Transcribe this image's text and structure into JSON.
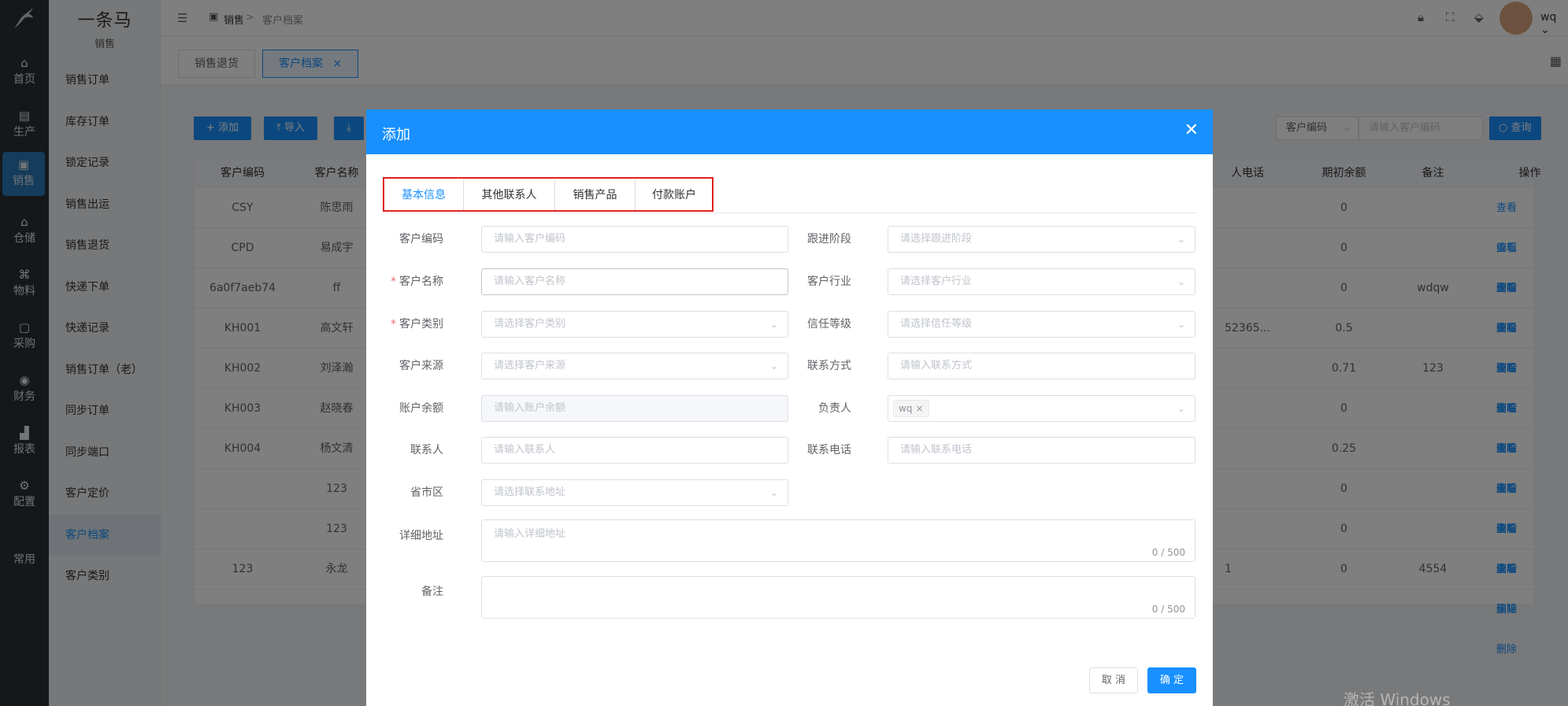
{
  "brand": {
    "name": "一条马",
    "module": "销售"
  },
  "rail": [
    {
      "label": "首页",
      "icon": "home-icon",
      "glyph": "⌂"
    },
    {
      "label": "生产",
      "icon": "factory-icon",
      "glyph": "▤"
    },
    {
      "label": "销售",
      "icon": "sales-icon",
      "glyph": "▣"
    },
    {
      "label": "仓储",
      "icon": "warehouse-icon",
      "glyph": "⌂"
    },
    {
      "label": "物料",
      "icon": "material-icon",
      "glyph": "⌘"
    },
    {
      "label": "采购",
      "icon": "purchase-icon",
      "glyph": "▢"
    },
    {
      "label": "财务",
      "icon": "finance-icon",
      "glyph": "◉"
    },
    {
      "label": "报表",
      "icon": "report-icon",
      "glyph": "▟"
    },
    {
      "label": "配置",
      "icon": "settings-icon",
      "glyph": "⚙"
    },
    {
      "label": "常用",
      "icon": "",
      "glyph": ""
    }
  ],
  "submenu": [
    "销售订单",
    "库存订单",
    "锁定记录",
    "销售出运",
    "销售退货",
    "快递下单",
    "快递记录",
    "销售订单（老）",
    "同步订单",
    "同步端口",
    "客户定价",
    "客户档案",
    "客户类别"
  ],
  "breadcrumb": {
    "first": "销售",
    "sep": ">",
    "current": "客户档案"
  },
  "topbar": {
    "user": "wq"
  },
  "tabs": [
    {
      "label": "销售退货"
    },
    {
      "label": "客户档案",
      "close": "×"
    }
  ],
  "toolbar": {
    "add": "+ 添加",
    "import": "⤒ 导入",
    "export": "⤓",
    "filter_select": "客户编码",
    "search_placeholder": "请输入客户编码",
    "query": "查询"
  },
  "table": {
    "headers": [
      "客户编码",
      "客户名称",
      "人电话",
      "期初余额",
      "备注",
      "操作"
    ],
    "ops": [
      "查看",
      "编辑",
      "删除"
    ],
    "rows": [
      {
        "code": "CSY",
        "name": "陈思雨",
        "phone": "",
        "balance": "0",
        "note": ""
      },
      {
        "code": "CPD",
        "name": "易成宇",
        "phone": "",
        "balance": "0",
        "note": ""
      },
      {
        "code": "6a0f7aeb74",
        "name": "ff",
        "phone": "",
        "balance": "0",
        "note": "wdqw"
      },
      {
        "code": "KH001",
        "name": "高文轩",
        "phone": "52365...",
        "balance": "0.5",
        "note": ""
      },
      {
        "code": "KH002",
        "name": "刘泽瀚",
        "phone": "",
        "balance": "0.71",
        "note": "123"
      },
      {
        "code": "KH003",
        "name": "赵晓春",
        "phone": "",
        "balance": "0",
        "note": ""
      },
      {
        "code": "KH004",
        "name": "杨文清",
        "phone": "",
        "balance": "0.25",
        "note": ""
      },
      {
        "code": "",
        "name": "123",
        "phone": "",
        "balance": "0",
        "note": ""
      },
      {
        "code": "",
        "name": "123",
        "phone": "",
        "balance": "0",
        "note": ""
      },
      {
        "code": "123",
        "name": "永龙",
        "phone": "1",
        "balance": "0",
        "note": "4554"
      }
    ]
  },
  "dialog": {
    "title": "添加",
    "tabs": [
      "基本信息",
      "其他联系人",
      "销售产品",
      "付款账户"
    ],
    "fields": {
      "code": {
        "label": "客户编码",
        "placeholder": "请输入客户编码"
      },
      "stage": {
        "label": "跟进阶段",
        "placeholder": "请选择跟进阶段"
      },
      "name": {
        "label": "客户名称",
        "placeholder": "请输入客户名称"
      },
      "industry": {
        "label": "客户行业",
        "placeholder": "请选择客户行业"
      },
      "type": {
        "label": "客户类别",
        "placeholder": "请选择客户类别"
      },
      "credit": {
        "label": "信任等级",
        "placeholder": "请选择信任等级"
      },
      "source": {
        "label": "客户来源",
        "placeholder": "请选择客户来源"
      },
      "contact_method": {
        "label": "联系方式",
        "placeholder": "请输入联系方式"
      },
      "balance": {
        "label": "账户余额",
        "placeholder": "请输入账户余额"
      },
      "owner": {
        "label": "负责人",
        "tag": "wq"
      },
      "contact": {
        "label": "联系人",
        "placeholder": "请输入联系人"
      },
      "phone": {
        "label": "联系电话",
        "placeholder": "请输入联系电话"
      },
      "region": {
        "label": "省市区",
        "placeholder": "请选择联系地址"
      },
      "address": {
        "label": "详细地址",
        "placeholder": "请输入详细地址",
        "counter": "0 / 500"
      },
      "remark": {
        "label": "备注",
        "placeholder": "",
        "counter": "0 / 500"
      }
    },
    "cancel": "取 消",
    "confirm": "确 定"
  },
  "watermark": "激活 Windows"
}
